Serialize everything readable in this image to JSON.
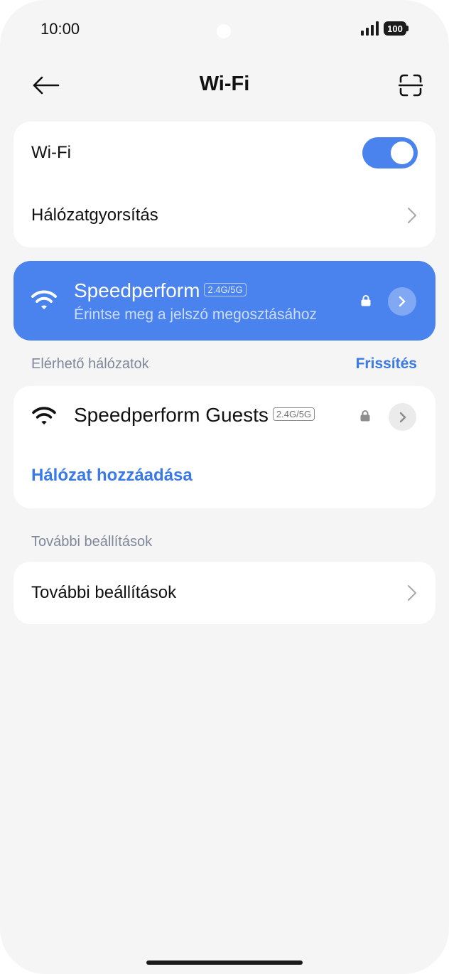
{
  "status_bar": {
    "time": "10:00",
    "battery": "100",
    "icons": [
      "signal-icon",
      "battery-icon"
    ]
  },
  "header": {
    "title": "Wi-Fi",
    "back_icon": "arrow-left-icon",
    "scan_icon": "scan-qr-icon"
  },
  "settings_card": {
    "wifi_label": "Wi-Fi",
    "wifi_enabled": true,
    "acceleration_label": "Hálózatgyorsítás"
  },
  "connected_network": {
    "name": "Speedperform",
    "band": "2.4G/5G",
    "subtitle": "Érintse meg a jelszó megosztásához",
    "secured": true
  },
  "available_networks": {
    "section_label": "Elérhető hálózatok",
    "refresh_label": "Frissítés",
    "networks": [
      {
        "name": "Speedperform Guests",
        "band": "2.4G/5G",
        "secured": true
      }
    ],
    "add_network_label": "Hálózat hozzáadása"
  },
  "more_settings": {
    "section_label": "További beállítások",
    "item_label": "További beállítások"
  },
  "colors": {
    "accent": "#4a83ee",
    "link": "#3a79e8",
    "background": "#f5f5f5",
    "card": "#ffffff"
  }
}
